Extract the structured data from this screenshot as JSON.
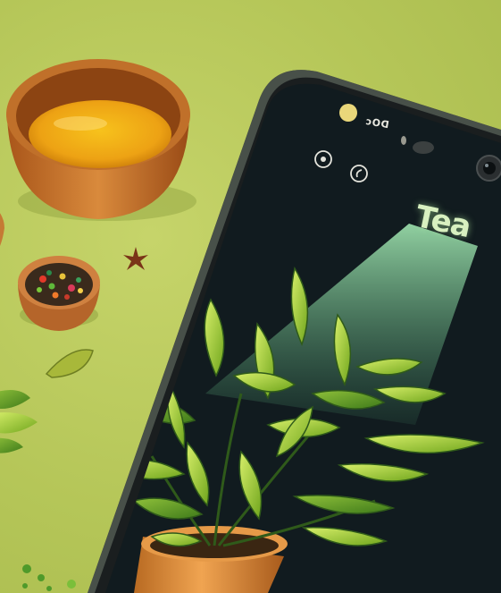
{
  "app": {
    "title": "Tea",
    "status_glyphs": "ɔOᗡ"
  },
  "colors": {
    "background": "#b9c95a",
    "phone_body": "#1a1e1f",
    "screen": "#111b1f",
    "tea_liquid": "#f2a310",
    "leaf": "#9ccc2c",
    "pot": "#d9852f",
    "spotlight": "#8fe6a6"
  },
  "icons": [
    "status-dot-icon",
    "play-icon",
    "back-icon",
    "camera-icon",
    "star-anise-icon",
    "leaf-icon"
  ]
}
